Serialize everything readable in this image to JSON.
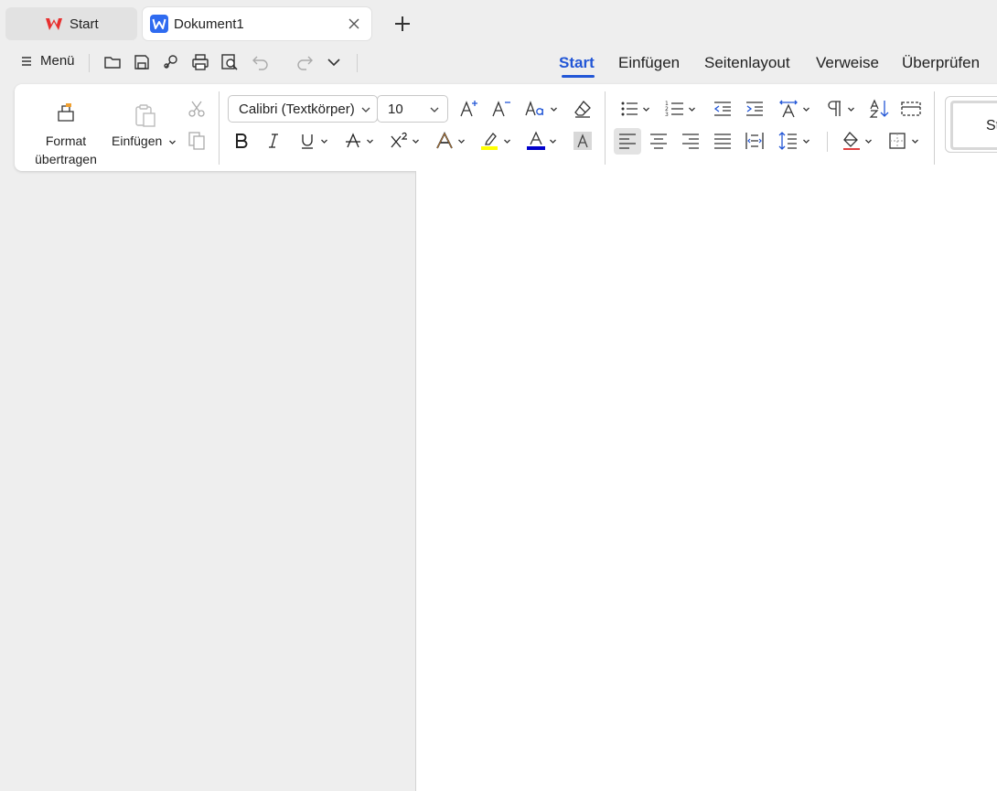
{
  "tabs": {
    "start_label": "Start",
    "document_label": "Dokument1"
  },
  "quick_access": {
    "menu_label": "Menü"
  },
  "ribbon_tabs": [
    {
      "label": "Start",
      "active": true
    },
    {
      "label": "Einfügen",
      "active": false
    },
    {
      "label": "Seitenlayout",
      "active": false
    },
    {
      "label": "Verweise",
      "active": false
    },
    {
      "label": "Überprüfen",
      "active": false
    }
  ],
  "ribbon": {
    "format_painter_label_1": "Format",
    "format_painter_label_2": "übertragen",
    "paste_label": "Einfügen",
    "font_name": "Calibri (Textkörper)",
    "font_size": "10",
    "style_preview": "Sta"
  },
  "colors": {
    "accent": "#2256d6",
    "highlight": "#ffff00",
    "font_color": "#0000cc"
  }
}
